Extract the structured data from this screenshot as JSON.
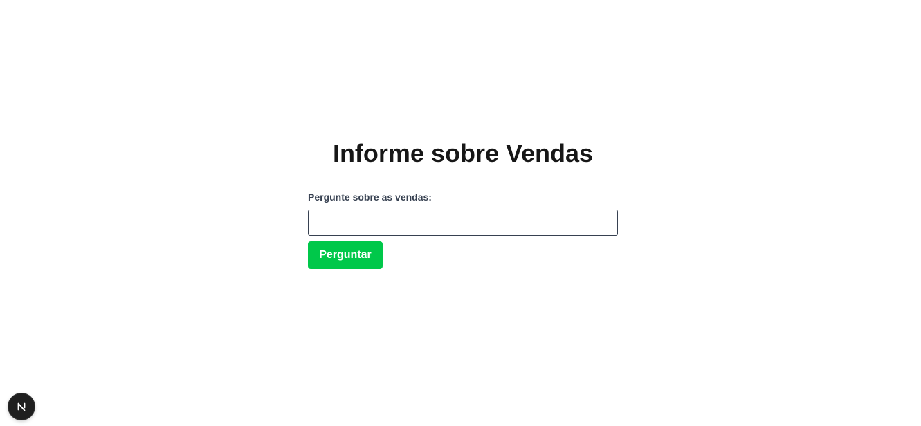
{
  "page": {
    "title": "Informe sobre Vendas"
  },
  "form": {
    "label": "Pergunte sobre as vendas:",
    "input_value": "",
    "input_placeholder": "",
    "submit_label": "Perguntar"
  },
  "dev_indicator": {
    "icon": "nextjs-logo-icon"
  },
  "colors": {
    "button_bg": "#00c84a",
    "title_text": "#171717",
    "label_text": "#374151"
  }
}
